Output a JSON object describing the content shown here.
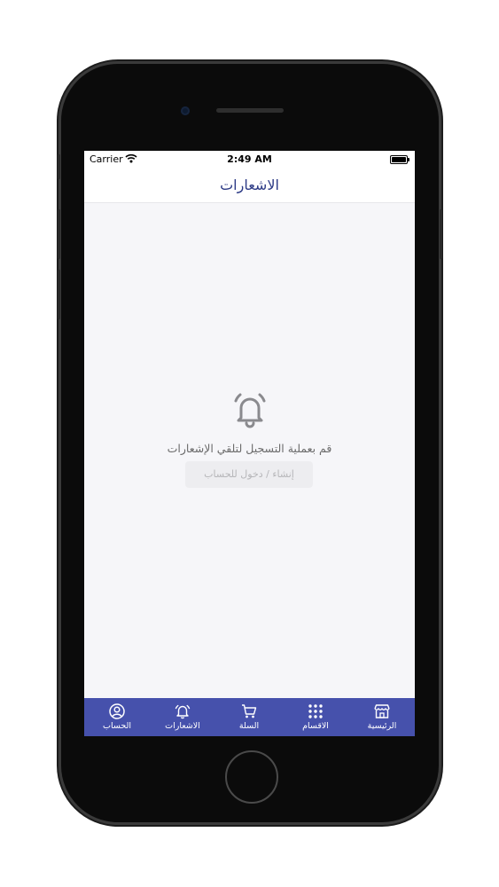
{
  "status_bar": {
    "carrier": "Carrier",
    "time": "2:49 AM"
  },
  "nav": {
    "title": "الاشعارات"
  },
  "empty_state": {
    "icon": "bell-icon",
    "message": "قم بعملية التسجيل لتلقي الإشعارات",
    "button_label": "إنشاء / دخول للحساب"
  },
  "tab_bar": {
    "background": "#4651ac",
    "tabs": [
      {
        "label": "الحساب",
        "icon": "account-icon"
      },
      {
        "label": "الاشعارات",
        "icon": "bell-icon"
      },
      {
        "label": "السلة",
        "icon": "cart-icon"
      },
      {
        "label": "الاقسام",
        "icon": "grid-icon"
      },
      {
        "label": "الرئيسية",
        "icon": "store-icon"
      }
    ]
  }
}
